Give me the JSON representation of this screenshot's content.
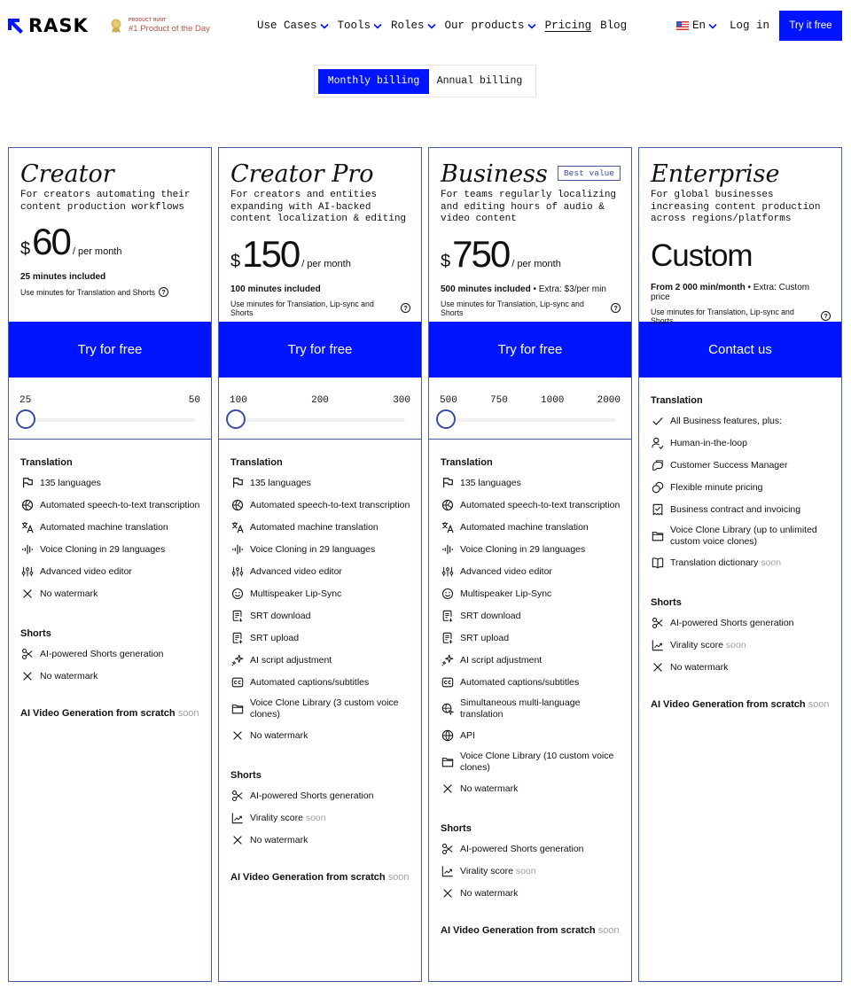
{
  "header": {
    "logo_text": "RASK",
    "badge_small": "PRODUCT HUNT",
    "badge_big": "#1 Product of the Day",
    "nav": [
      {
        "label": "Use Cases",
        "dropdown": true
      },
      {
        "label": "Tools",
        "dropdown": true
      },
      {
        "label": "Roles",
        "dropdown": true
      },
      {
        "label": "Our products",
        "dropdown": true
      },
      {
        "label": "Pricing",
        "dropdown": false,
        "active": true
      },
      {
        "label": "Blog",
        "dropdown": false
      }
    ],
    "language": "En",
    "login": "Log in",
    "cta": "Try it free"
  },
  "billing": {
    "monthly": "Monthly billing",
    "annual": "Annual billing",
    "selected": "monthly"
  },
  "colors": {
    "accent": "#0015ff",
    "border": "#4a5ba8",
    "soon": "#a0a0a0"
  },
  "plans": [
    {
      "name": "Creator",
      "desc": "For creators automating their\ncontent production workflows",
      "currency": "$",
      "price": "60",
      "per": "/ per month",
      "minutes_bold": "25 minutes included",
      "minutes_extra": "",
      "use_minutes": "Use minutes for Translation and Shorts",
      "cta": "Try for free",
      "slider_ticks": [
        "25",
        "50"
      ],
      "slider_value": "25",
      "translation_title": "Translation",
      "translation": [
        {
          "icon": "flag-icon",
          "text": "135 languages"
        },
        {
          "icon": "speech-to-text-icon",
          "text": "Automated speech-to-text transcription"
        },
        {
          "icon": "translate-icon",
          "text": "Automated machine translation"
        },
        {
          "icon": "waveform-icon",
          "text": "Voice Cloning in 29 languages"
        },
        {
          "icon": "sliders-icon",
          "text": "Advanced video editor"
        },
        {
          "icon": "x-icon",
          "text": "No watermark"
        }
      ],
      "shorts_title": "Shorts",
      "shorts": [
        {
          "icon": "scissors-icon",
          "text": "AI-powered Shorts generation"
        },
        {
          "icon": "x-icon",
          "text": "No watermark"
        }
      ],
      "bottom": "AI Video Generation from scratch",
      "bottom_soon": "soon"
    },
    {
      "name": "Creator Pro",
      "desc": "For creators and entities\nexpanding with AI-backed\ncontent localization & editing",
      "currency": "$",
      "price": "150",
      "per": "/ per month",
      "minutes_bold": "100 minutes included",
      "minutes_extra": "",
      "use_minutes": "Use minutes for Translation, Lip-sync and Shorts",
      "cta": "Try for free",
      "slider_ticks": [
        "100",
        "200",
        "300"
      ],
      "slider_value": "100",
      "translation_title": "Translation",
      "translation": [
        {
          "icon": "flag-icon",
          "text": "135 languages"
        },
        {
          "icon": "speech-to-text-icon",
          "text": "Automated speech-to-text transcription"
        },
        {
          "icon": "translate-icon",
          "text": "Automated machine translation"
        },
        {
          "icon": "waveform-icon",
          "text": "Voice Cloning in 29 languages"
        },
        {
          "icon": "sliders-icon",
          "text": "Advanced video editor"
        },
        {
          "icon": "smiley-icon",
          "text": "Multispeaker Lip-Sync"
        },
        {
          "icon": "file-download-icon",
          "text": "SRT download"
        },
        {
          "icon": "file-upload-icon",
          "text": "SRT upload"
        },
        {
          "icon": "sparkle-icon",
          "text": "AI script adjustment"
        },
        {
          "icon": "cc-icon",
          "text": "Automated captions/subtitles"
        },
        {
          "icon": "folder-icon",
          "text": "Voice Clone Library (3 custom voice clones)"
        },
        {
          "icon": "x-icon",
          "text": "No watermark"
        }
      ],
      "shorts_title": "Shorts",
      "shorts": [
        {
          "icon": "scissors-icon",
          "text": "AI-powered Shorts generation"
        },
        {
          "icon": "chart-icon",
          "text": "Virality score",
          "soon": "soon"
        },
        {
          "icon": "x-icon",
          "text": "No watermark"
        }
      ],
      "bottom": "AI Video Generation from scratch",
      "bottom_soon": "soon"
    },
    {
      "name": "Business",
      "badge": "Best value",
      "desc": "For teams regularly localizing\nand editing hours of audio &\nvideo content",
      "currency": "$",
      "price": "750",
      "per": "/ per month",
      "minutes_bold": "500 minutes included",
      "minutes_extra": " • Extra: $3/per min",
      "use_minutes": "Use minutes for Translation, Lip-sync and Shorts",
      "cta": "Try for free",
      "slider_ticks": [
        "500",
        "750",
        "1000",
        "2000"
      ],
      "slider_value": "500",
      "translation_title": "Translation",
      "translation": [
        {
          "icon": "flag-icon",
          "text": "135 languages"
        },
        {
          "icon": "speech-to-text-icon",
          "text": "Automated speech-to-text transcription"
        },
        {
          "icon": "translate-icon",
          "text": "Automated machine translation"
        },
        {
          "icon": "waveform-icon",
          "text": "Voice Cloning in 29 languages"
        },
        {
          "icon": "sliders-icon",
          "text": "Advanced video editor"
        },
        {
          "icon": "smiley-icon",
          "text": "Multispeaker Lip-Sync"
        },
        {
          "icon": "file-download-icon",
          "text": "SRT download"
        },
        {
          "icon": "file-upload-icon",
          "text": "SRT upload"
        },
        {
          "icon": "sparkle-icon",
          "text": "AI script adjustment"
        },
        {
          "icon": "cc-icon",
          "text": "Automated captions/subtitles"
        },
        {
          "icon": "multi-language-icon",
          "text": "Simultaneous multi-language translation"
        },
        {
          "icon": "globe-icon",
          "text": "API"
        },
        {
          "icon": "folder-icon",
          "text": "Voice Clone Library (10 custom voice clones)"
        },
        {
          "icon": "x-icon",
          "text": "No watermark"
        }
      ],
      "shorts_title": "Shorts",
      "shorts": [
        {
          "icon": "scissors-icon",
          "text": "AI-powered Shorts generation"
        },
        {
          "icon": "chart-icon",
          "text": "Virality score",
          "soon": "soon"
        },
        {
          "icon": "x-icon",
          "text": "No watermark"
        }
      ],
      "bottom": "AI Video Generation from scratch",
      "bottom_soon": "soon"
    },
    {
      "name": "Enterprise",
      "desc": "For global businesses\nincreasing content production\nacross regions/platforms",
      "price_custom": "Custom",
      "minutes_bold": "From 2 000 min/month",
      "minutes_extra": " • Extra: Custom price",
      "use_minutes": "Use minutes for Translation, Lip-sync and Shorts",
      "cta": "Contact us",
      "translation_title": "Translation",
      "translation": [
        {
          "icon": "check-icon",
          "text": "All Business features, plus:"
        },
        {
          "icon": "human-icon",
          "text": "Human-in-the-loop"
        },
        {
          "icon": "chat-icon",
          "text": "Customer Success Manager"
        },
        {
          "icon": "coins-icon",
          "text": "Flexible minute pricing"
        },
        {
          "icon": "receipt-icon",
          "text": "Business contract and invoicing"
        },
        {
          "icon": "folder-icon",
          "text": "Voice Clone Library (up to unlimited custom voice clones)"
        },
        {
          "icon": "book-icon",
          "text": "Translation dictionary",
          "soon": "soon"
        }
      ],
      "shorts_title": "Shorts",
      "shorts": [
        {
          "icon": "scissors-icon",
          "text": "AI-powered Shorts generation"
        },
        {
          "icon": "chart-icon",
          "text": "Virality score",
          "soon": "soon"
        },
        {
          "icon": "x-icon",
          "text": "No watermark"
        }
      ],
      "bottom": "AI Video Generation from scratch",
      "bottom_soon": "soon"
    }
  ]
}
